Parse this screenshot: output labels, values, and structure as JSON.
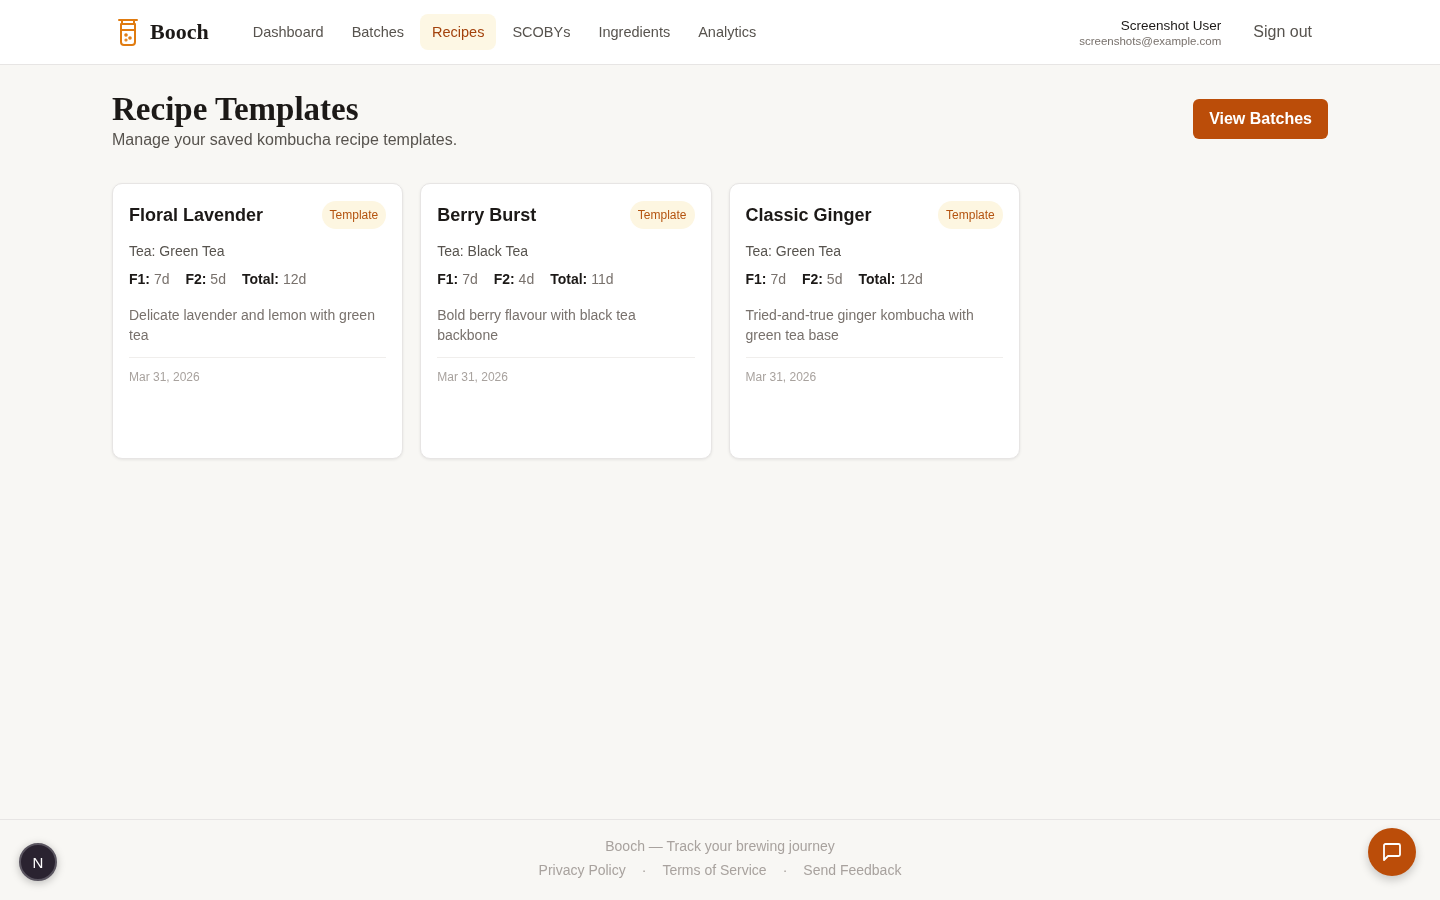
{
  "header": {
    "brand": "Booch",
    "nav": [
      {
        "label": "Dashboard",
        "selected": false
      },
      {
        "label": "Batches",
        "selected": false
      },
      {
        "label": "Recipes",
        "selected": true
      },
      {
        "label": "SCOBYs",
        "selected": false
      },
      {
        "label": "Ingredients",
        "selected": false
      },
      {
        "label": "Analytics",
        "selected": false
      }
    ],
    "user": {
      "name": "Screenshot User",
      "email": "screenshots@example.com"
    },
    "sign_out": "Sign out"
  },
  "page": {
    "title": "Recipe Templates",
    "subtitle": "Manage your saved kombucha recipe templates.",
    "action": "View Batches"
  },
  "recipes": [
    {
      "name": "Floral Lavender",
      "badge": "Template",
      "tea": "Tea: Green Tea",
      "stats": [
        {
          "label": "F1:",
          "value": "7d"
        },
        {
          "label": "F2:",
          "value": "5d"
        },
        {
          "label": "Total:",
          "value": "12d"
        }
      ],
      "description": "Delicate lavender and lemon with green tea",
      "date": "Mar 31, 2026"
    },
    {
      "name": "Berry Burst",
      "badge": "Template",
      "tea": "Tea: Black Tea",
      "stats": [
        {
          "label": "F1:",
          "value": "7d"
        },
        {
          "label": "F2:",
          "value": "4d"
        },
        {
          "label": "Total:",
          "value": "11d"
        }
      ],
      "description": "Bold berry flavour with black tea backbone",
      "date": "Mar 31, 2026"
    },
    {
      "name": "Classic Ginger",
      "badge": "Template",
      "tea": "Tea: Green Tea",
      "stats": [
        {
          "label": "F1:",
          "value": "7d"
        },
        {
          "label": "F2:",
          "value": "5d"
        },
        {
          "label": "Total:",
          "value": "12d"
        }
      ],
      "description": "Tried-and-true ginger kombucha with green tea base",
      "date": "Mar 31, 2026"
    }
  ],
  "footer": {
    "tagline": "Booch — Track your brewing journey",
    "links": [
      "Privacy Policy",
      "Terms of Service",
      "Send Feedback"
    ],
    "separators": [
      "·",
      "·"
    ]
  },
  "dev_indicator": {
    "label": "N"
  }
}
